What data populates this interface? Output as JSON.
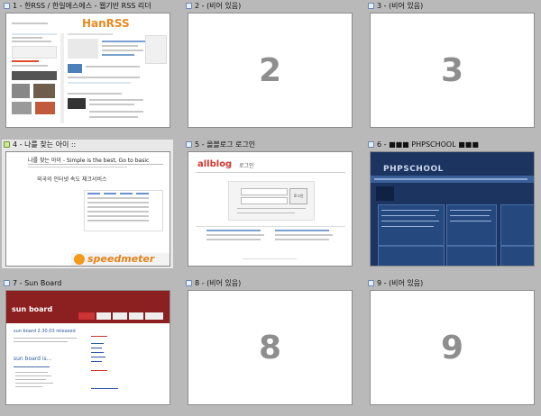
{
  "tiles": [
    {
      "index": 1,
      "title": "1 - 한RSS / 한일에스에스 - 웹기반 RSS 리더"
    },
    {
      "index": 2,
      "title": "2 - (비어 있음)",
      "number": "2"
    },
    {
      "index": 3,
      "title": "3 - (비어 있음)",
      "number": "3"
    },
    {
      "index": 4,
      "title": "4 - 나를 찾는 아이 ::"
    },
    {
      "index": 5,
      "title": "5 - 올블로그 로그인"
    },
    {
      "index": 6,
      "title": "6 - ■■■ PHPSCHOOL ■■■"
    },
    {
      "index": 7,
      "title": "7 - Sun Board"
    },
    {
      "index": 8,
      "title": "8 - (비어 있음)",
      "number": "8"
    },
    {
      "index": 9,
      "title": "9 - (비어 있음)",
      "number": "9"
    }
  ],
  "hanrss": {
    "logo": "HanRSS"
  },
  "nareul": {
    "headline": "나를 찾는 아이 - Simple is the best, Go to basic",
    "subhead": "외국의 인터넷 속도 체크서비스",
    "speedmeter": "speedmeter"
  },
  "allblog": {
    "logo": "allblog",
    "title": "로그인",
    "btn": "로그인"
  },
  "phpschool": {
    "logo": "PHPSCHOOL"
  },
  "sunboard": {
    "logo": "sun board",
    "post_title": "sun board 2.30.03 released",
    "post2": "sun board is..."
  }
}
